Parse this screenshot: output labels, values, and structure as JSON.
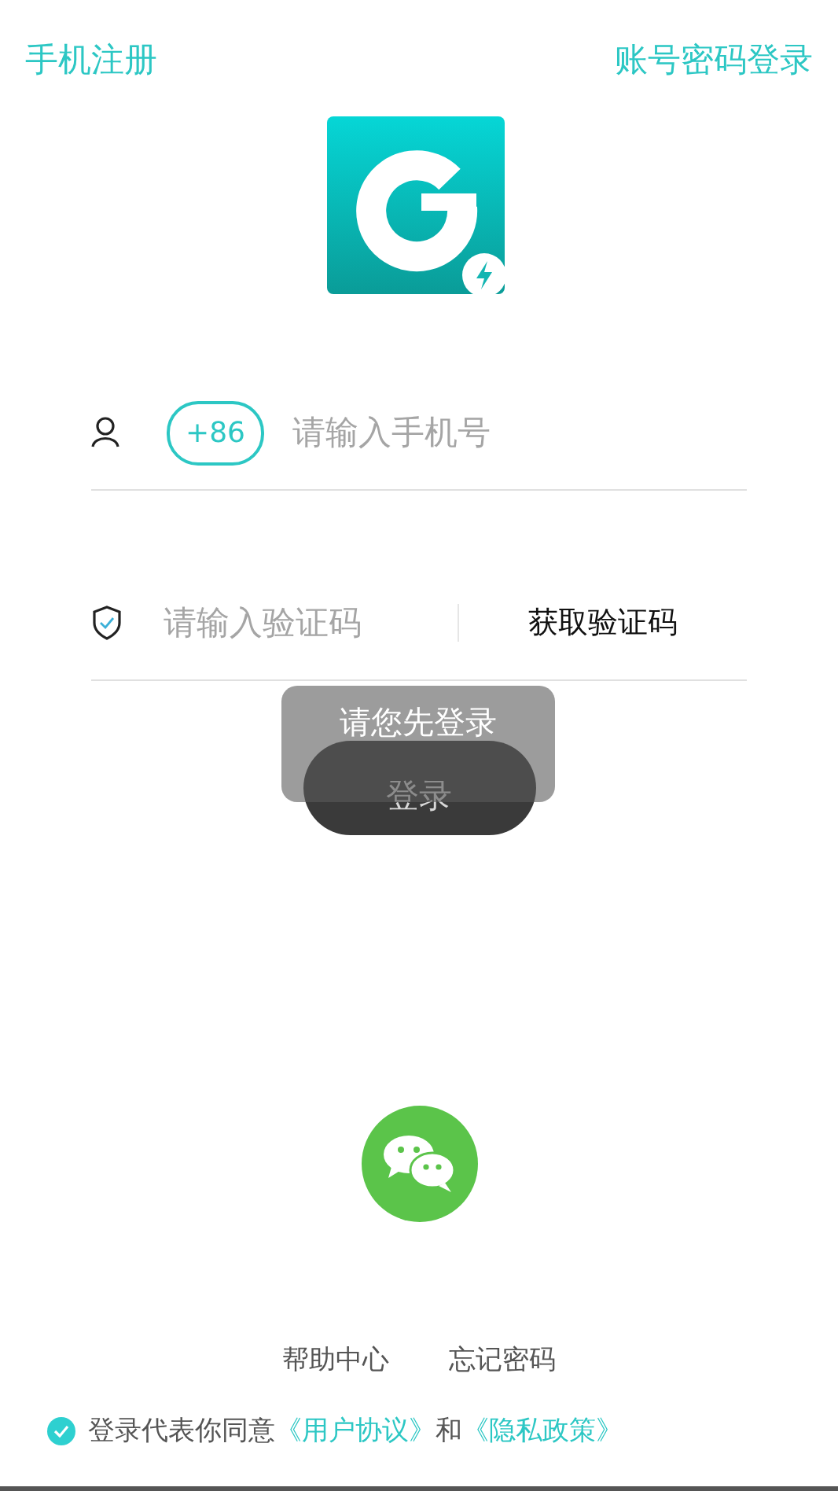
{
  "top_bar": {
    "left_link": "手机注册",
    "right_link": "账号密码登录"
  },
  "phone_field": {
    "country_code": "+86",
    "placeholder": "请输入手机号"
  },
  "code_field": {
    "placeholder": "请输入验证码",
    "action": "获取验证码"
  },
  "login_button": {
    "label": "登录",
    "disabled": true
  },
  "toast": {
    "message": "请您先登录"
  },
  "footer_links": [
    "帮助中心",
    "忘记密码"
  ],
  "agreement": {
    "checked": true,
    "text": "登录代表你同意",
    "links": [
      {
        "label": "《用户协议》"
      },
      {
        "label": "《隐私政策》"
      }
    ],
    "conjunction": "和"
  }
}
